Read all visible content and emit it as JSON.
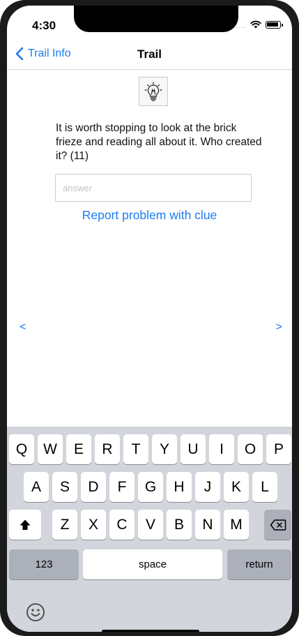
{
  "status": {
    "time": "4:30",
    "signal": "....."
  },
  "nav": {
    "back_label": "Trail Info",
    "title": "Trail"
  },
  "clue": {
    "icon": "lightbulb-icon",
    "text": "It is worth stopping to look at the brick frieze and reading all about it. Who created it? (11)"
  },
  "answer": {
    "value": "",
    "placeholder": "answer"
  },
  "report_label": "Report problem with clue",
  "pager": {
    "prev": "<",
    "next": ">"
  },
  "keyboard": {
    "row1": [
      "Q",
      "W",
      "E",
      "R",
      "T",
      "Y",
      "U",
      "I",
      "O",
      "P"
    ],
    "row2": [
      "A",
      "S",
      "D",
      "F",
      "G",
      "H",
      "J",
      "K",
      "L"
    ],
    "row3": [
      "Z",
      "X",
      "C",
      "V",
      "B",
      "N",
      "M"
    ],
    "numbers_label": "123",
    "space_label": "space",
    "return_label": "return"
  },
  "colors": {
    "accent": "#1a7cf4",
    "keyboard_bg": "#d2d5db",
    "key_dark": "#abb0ba"
  }
}
